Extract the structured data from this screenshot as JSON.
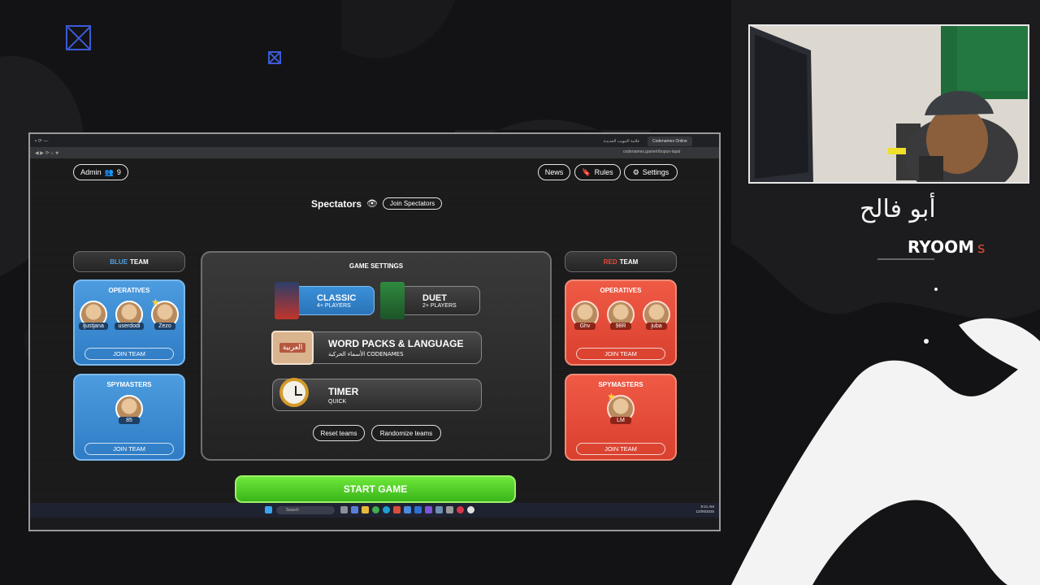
{
  "overlay": {
    "streamer_name": "أبو فالح",
    "channel_tag": "RYOOM",
    "channel_tag_suffix": "s"
  },
  "browser": {
    "tabs": [
      {
        "label": "علامة التبويب الجديدة",
        "active": false
      },
      {
        "label": "Codenames Online",
        "active": true
      }
    ],
    "url": "codenames.game/r/bopun-lapal"
  },
  "header": {
    "admin_label": "Admin",
    "admin_count": "9",
    "news_label": "News",
    "rules_label": "Rules",
    "settings_label": "Settings"
  },
  "spectators": {
    "title": "Spectators",
    "join_label": "Join Spectators"
  },
  "blue_team": {
    "title_color_word": "BLUE",
    "title_word": "TEAM",
    "operatives_title": "OPERATIVES",
    "operatives": [
      "ljustjana",
      "userdodi",
      "Zezo"
    ],
    "spymasters_title": "SPYMASTERS",
    "spymasters": [
      "85"
    ],
    "join_label": "JOIN TEAM"
  },
  "red_team": {
    "title_color_word": "RED",
    "title_word": "TEAM",
    "operatives_title": "OPERATIVES",
    "operatives": [
      "Ghv",
      "98R",
      "juba"
    ],
    "spymasters_title": "SPYMASTERS",
    "spymasters": [
      "LM"
    ],
    "join_label": "JOIN TEAM"
  },
  "game_settings": {
    "title": "GAME SETTINGS",
    "modes": [
      {
        "name": "CLASSIC",
        "players": "4+ PLAYERS",
        "selected": true
      },
      {
        "name": "DUET",
        "players": "2+ PLAYERS",
        "selected": false
      }
    ],
    "word_packs": {
      "title": "WORD PACKS & LANGUAGE",
      "subtitle": "الأسماء الحركية CODENAMES",
      "badge": "العربية"
    },
    "timer": {
      "title": "TIMER",
      "subtitle": "QUICK"
    },
    "reset_label": "Reset teams",
    "randomize_label": "Randomize teams"
  },
  "start_label": "START GAME",
  "taskbar": {
    "search_placeholder": "Search",
    "time": "9:21 AM",
    "date": "12/09/2025"
  },
  "colors": {
    "blue_team": "#3a8ad6",
    "red_team": "#e04a36",
    "start_green": "#4fcb22"
  }
}
